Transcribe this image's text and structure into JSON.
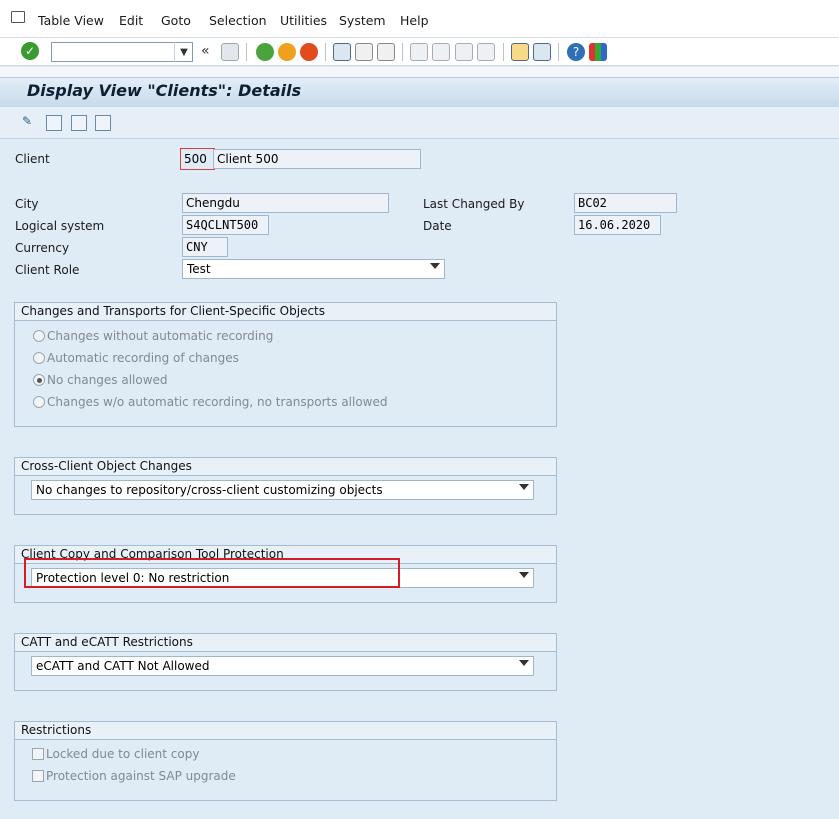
{
  "menu": [
    "Table View",
    "Edit",
    "Goto",
    "Selection",
    "Utilities",
    "System",
    "Help"
  ],
  "toolbar": {
    "command_field": ""
  },
  "title": "Display View \"Clients\": Details",
  "fields": {
    "client_label": "Client",
    "client_value": "500",
    "client_name": "Client 500",
    "city_label": "City",
    "city_value": "Chengdu",
    "logical_system_label": "Logical system",
    "logical_system_value": "S4QCLNT500",
    "currency_label": "Currency",
    "currency_value": "CNY",
    "client_role_label": "Client Role",
    "client_role_value": "Test",
    "last_changed_by_label": "Last Changed By",
    "last_changed_by_value": "BC02",
    "date_label": "Date",
    "date_value": "16.06.2020"
  },
  "groups": {
    "changes": {
      "title": "Changes and Transports for Client-Specific Objects",
      "options": [
        "Changes without automatic recording",
        "Automatic recording of changes",
        "No changes allowed",
        "Changes w/o automatic recording, no transports allowed"
      ],
      "selected_index": 2
    },
    "cross_client": {
      "title": "Cross-Client Object Changes",
      "value": "No changes to repository/cross-client customizing objects"
    },
    "copy_protection": {
      "title": "Client Copy and Comparison Tool Protection",
      "value": "Protection level 0: No restriction"
    },
    "catt": {
      "title": "CATT and eCATT Restrictions",
      "value": "eCATT and CATT Not Allowed"
    },
    "restrictions": {
      "title": "Restrictions",
      "options": [
        "Locked due to client copy",
        "Protection against SAP upgrade"
      ]
    }
  },
  "colors": {
    "accent_red": "#d21e28",
    "background": "#dfebf5"
  }
}
